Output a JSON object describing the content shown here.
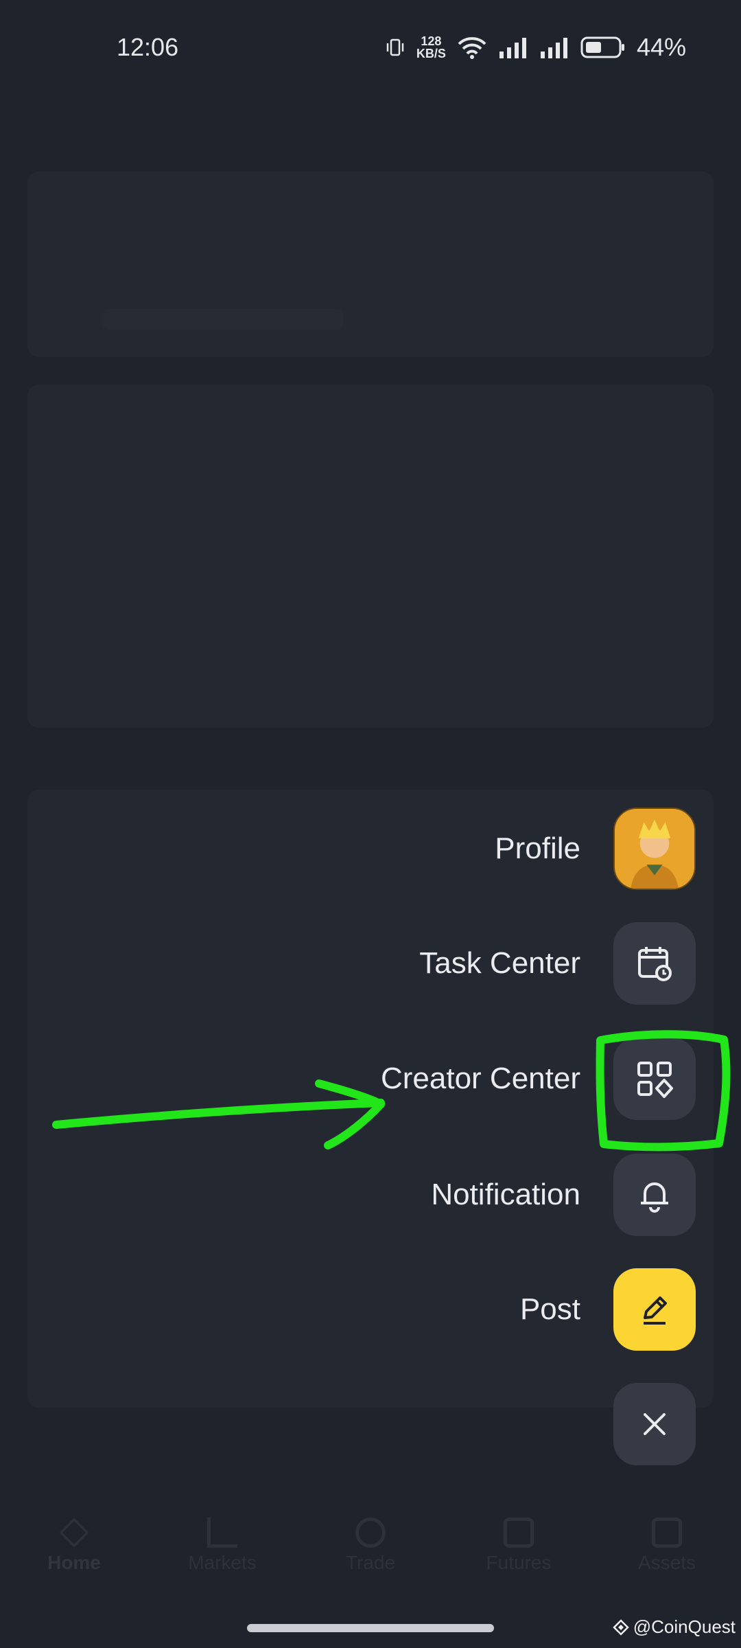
{
  "status_bar": {
    "time": "12:06",
    "speed_value": "128",
    "speed_unit": "KB/S",
    "battery_percent": "44%"
  },
  "menu": {
    "profile_label": "Profile",
    "task_center_label": "Task Center",
    "creator_center_label": "Creator Center",
    "notification_label": "Notification",
    "post_label": "Post"
  },
  "bottom_nav": {
    "items": [
      {
        "label": "Home"
      },
      {
        "label": "Markets"
      },
      {
        "label": "Trade"
      },
      {
        "label": "Futures"
      },
      {
        "label": "Assets"
      }
    ]
  },
  "watermark": "@CoinQuest",
  "colors": {
    "background": "#1f232b",
    "menu_button": "#353a44",
    "post_button": "#fcd535",
    "annotation": "#22e619"
  }
}
